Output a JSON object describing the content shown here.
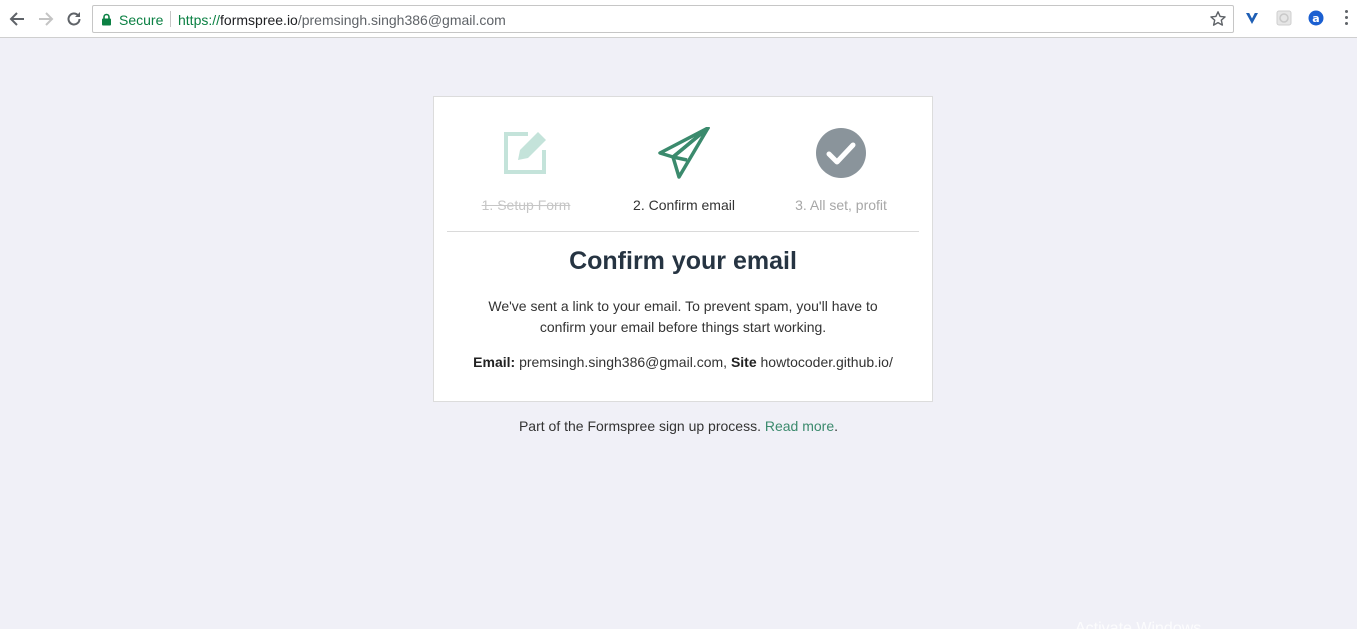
{
  "browser": {
    "secure_label": "Secure",
    "url_scheme": "https://",
    "url_host": "formspree.io",
    "url_path": "/premsingh.singh386@gmail.com",
    "icons": [
      "back-arrow-icon",
      "forward-arrow-icon",
      "reload-icon",
      "lock-icon",
      "star-icon",
      "extension-v-icon",
      "extension-puzzle-icon",
      "extension-a-icon",
      "menu-dots-icon"
    ],
    "accent_color": "#0b8043"
  },
  "steps": [
    {
      "label": "1. Setup Form",
      "icon": "edit-icon",
      "state": "done"
    },
    {
      "label": "2. Confirm email",
      "icon": "paper-plane-icon",
      "state": "current"
    },
    {
      "label": "3. All set, profit",
      "icon": "check-circle-icon",
      "state": "upcoming"
    }
  ],
  "main": {
    "title": "Confirm your email",
    "description": "We've sent a link to your email. To prevent spam, you'll have to confirm your email before things start working.",
    "email_label": "Email:",
    "email_value": "premsingh.singh386@gmail.com,",
    "site_label": "Site",
    "site_value": "howtocoder.github.io/"
  },
  "footer": {
    "text": "Part of the Formspree sign up process.",
    "link": "Read more",
    "suffix": "."
  },
  "colors": {
    "brand_green": "#3b8a6d",
    "background": "#f0f0f7",
    "check_gray": "#8a949b"
  },
  "watermark": "Activate Windows"
}
